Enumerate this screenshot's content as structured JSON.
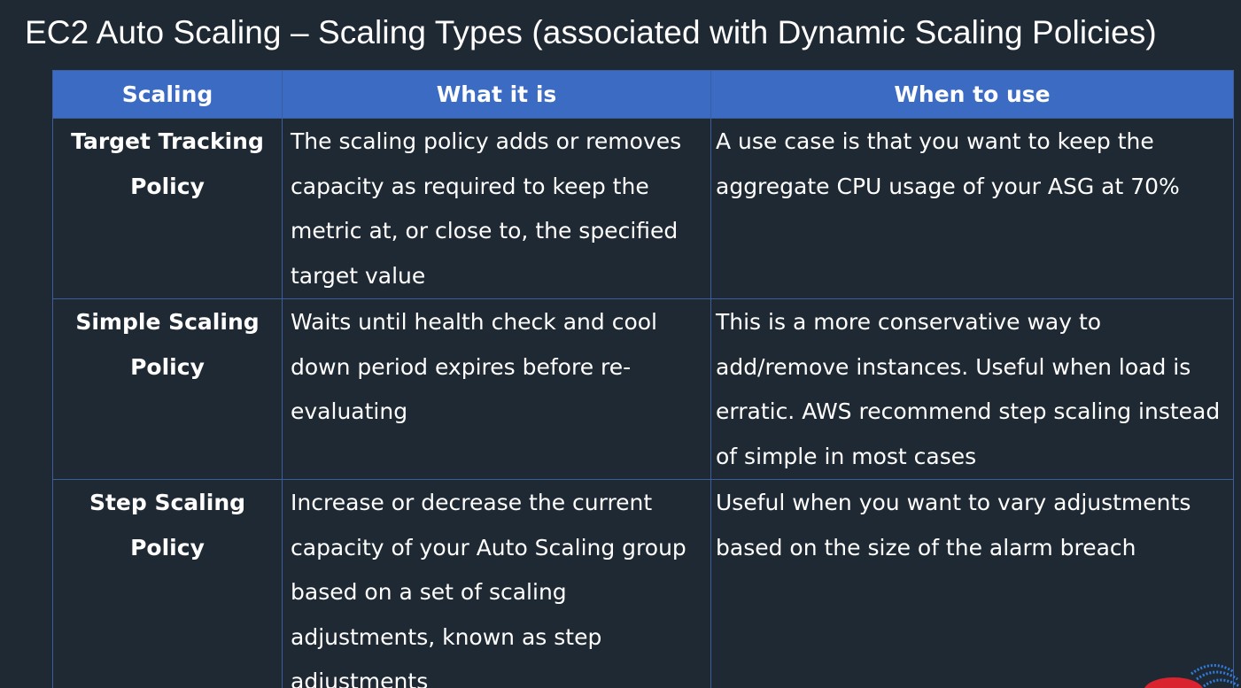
{
  "title": "EC2 Auto Scaling – Scaling Types (associated with Dynamic Scaling Policies)",
  "table": {
    "headers": [
      "Scaling",
      "What it is",
      "When to use"
    ],
    "rows": [
      {
        "scaling": "Target Tracking Policy",
        "what": "The scaling policy adds or removes capacity as required to keep the metric at, or close to, the specified target value",
        "when": "A use case is that you want to keep the aggregate CPU usage of your ASG at 70%"
      },
      {
        "scaling": "Simple Scaling Policy",
        "what": "Waits until health check and cool down period expires before re-evaluating",
        "when": "This is a more conservative way to add/remove instances. Useful when load is erratic. AWS recommend step scaling instead of simple in most cases"
      },
      {
        "scaling": "Step Scaling Policy",
        "what": "Increase or decrease the current capacity of your Auto Scaling group based on a set of scaling adjustments, known as step adjustments",
        "when": "Useful when you want to vary adjustments based on the size of the alarm breach"
      }
    ]
  },
  "colors": {
    "background": "#1f2933",
    "header_fill": "#3c6bc4",
    "grid_line": "#3a5f9c",
    "text": "#ffffff"
  }
}
